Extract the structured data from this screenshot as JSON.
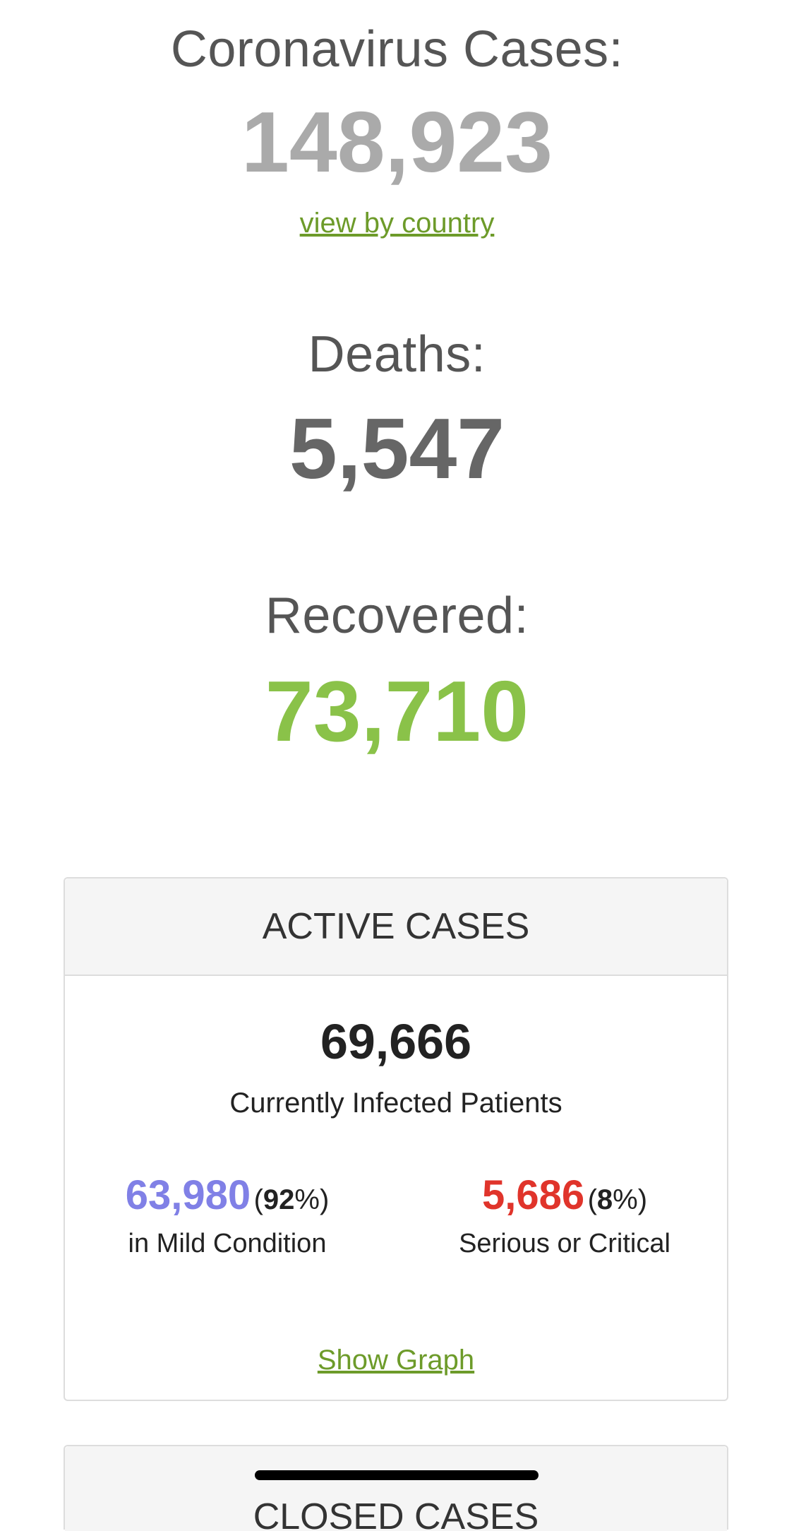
{
  "cases": {
    "label": "Coronavirus Cases:",
    "value": "148,923",
    "link": "view by country"
  },
  "deaths": {
    "label": "Deaths:",
    "value": "5,547"
  },
  "recovered": {
    "label": "Recovered:",
    "value": "73,710"
  },
  "active_cases": {
    "title": "ACTIVE CASES",
    "total": "69,666",
    "total_label": "Currently Infected Patients",
    "mild": {
      "value": "63,980",
      "percent": "92",
      "label": "in Mild Condition"
    },
    "serious": {
      "value": "5,686",
      "percent": "8",
      "label": "Serious or Critical"
    },
    "show_graph": "Show Graph"
  },
  "closed_cases": {
    "title": "CLOSED CASES"
  },
  "colors": {
    "cases": "#aaaaaa",
    "deaths": "#666666",
    "recovered": "#8ac249",
    "mild": "#8080e6",
    "serious": "#e0342b",
    "link": "#6d9b2a"
  }
}
